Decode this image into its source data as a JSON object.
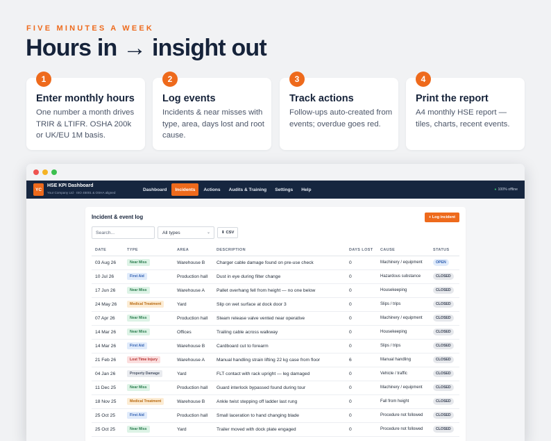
{
  "eyebrow": "FIVE MINUTES A WEEK",
  "headline": "Hours in → insight out",
  "steps": [
    {
      "num": "1",
      "title": "Enter monthly hours",
      "body": "One number a month drives TRIR & LTIFR. OSHA 200k or UK/EU 1M basis."
    },
    {
      "num": "2",
      "title": "Log events",
      "body": "Incidents & near misses with type, area, days lost and root cause."
    },
    {
      "num": "3",
      "title": "Track actions",
      "body": "Follow-ups auto-created from events; overdue goes red."
    },
    {
      "num": "4",
      "title": "Print the report",
      "body": "A4 monthly HSE report — tiles, charts, recent events."
    }
  ],
  "app": {
    "logo": "YC",
    "title": "HSE KPI Dashboard",
    "subtitle": "Your Company Ltd · ISO 45001 & OSHA aligned",
    "nav": [
      "Dashboard",
      "Incidents",
      "Actions",
      "Audits & Training",
      "Settings",
      "Help"
    ],
    "active_nav": "Incidents",
    "offline": "100% offline"
  },
  "panel": {
    "title": "Incident & event log",
    "log_button": "+ Log incident",
    "search_placeholder": "Search...",
    "type_filter": "All types",
    "csv_button": "⬇ CSV"
  },
  "table": {
    "columns": [
      "DATE",
      "TYPE",
      "AREA",
      "DESCRIPTION",
      "DAYS LOST",
      "CAUSE",
      "STATUS"
    ],
    "rows": [
      {
        "date": "03 Aug 26",
        "type": "Near Miss",
        "area": "Warehouse B",
        "description": "Charger cable damage found on pre-use check",
        "days": "0",
        "cause": "Machinery / equipment",
        "status": "OPEN"
      },
      {
        "date": "10 Jul 26",
        "type": "First Aid",
        "area": "Production hall",
        "description": "Dust in eye during filter change",
        "days": "0",
        "cause": "Hazardous substance",
        "status": "CLOSED"
      },
      {
        "date": "17 Jun 26",
        "type": "Near Miss",
        "area": "Warehouse A",
        "description": "Pallet overhang fell from height — no one below",
        "days": "0",
        "cause": "Housekeeping",
        "status": "CLOSED"
      },
      {
        "date": "24 May 26",
        "type": "Medical Treatment",
        "area": "Yard",
        "description": "Slip on wet surface at dock door 3",
        "days": "0",
        "cause": "Slips / trips",
        "status": "CLOSED"
      },
      {
        "date": "07 Apr 26",
        "type": "Near Miss",
        "area": "Production hall",
        "description": "Steam release valve vented near operative",
        "days": "0",
        "cause": "Machinery / equipment",
        "status": "CLOSED"
      },
      {
        "date": "14 Mar 26",
        "type": "Near Miss",
        "area": "Offices",
        "description": "Trailing cable across walkway",
        "days": "0",
        "cause": "Housekeeping",
        "status": "CLOSED"
      },
      {
        "date": "14 Mar 26",
        "type": "First Aid",
        "area": "Warehouse B",
        "description": "Cardboard cut to forearm",
        "days": "0",
        "cause": "Slips / trips",
        "status": "CLOSED"
      },
      {
        "date": "21 Feb 26",
        "type": "Lost Time Injury",
        "area": "Warehouse A",
        "description": "Manual handling strain lifting 22 kg case from floor",
        "days": "6",
        "cause": "Manual handling",
        "status": "CLOSED"
      },
      {
        "date": "04 Jan 26",
        "type": "Property Damage",
        "area": "Yard",
        "description": "FLT contact with rack upright — leg damaged",
        "days": "0",
        "cause": "Vehicle / traffic",
        "status": "CLOSED"
      },
      {
        "date": "11 Dec 25",
        "type": "Near Miss",
        "area": "Production hall",
        "description": "Guard interlock bypassed found during tour",
        "days": "0",
        "cause": "Machinery / equipment",
        "status": "CLOSED"
      },
      {
        "date": "18 Nov 25",
        "type": "Medical Treatment",
        "area": "Warehouse B",
        "description": "Ankle twist stepping off ladder last rung",
        "days": "0",
        "cause": "Fall from height",
        "status": "CLOSED"
      },
      {
        "date": "25 Oct 25",
        "type": "First Aid",
        "area": "Production hall",
        "description": "Small laceration to hand changing blade",
        "days": "0",
        "cause": "Procedure not followed",
        "status": "CLOSED"
      },
      {
        "date": "25 Oct 25",
        "type": "Near Miss",
        "area": "Yard",
        "description": "Trailer moved with dock plate engaged",
        "days": "0",
        "cause": "Procedure not followed",
        "status": "CLOSED"
      }
    ]
  },
  "colors": {
    "accent": "#ee6a1c",
    "navbar": "#16263f"
  }
}
